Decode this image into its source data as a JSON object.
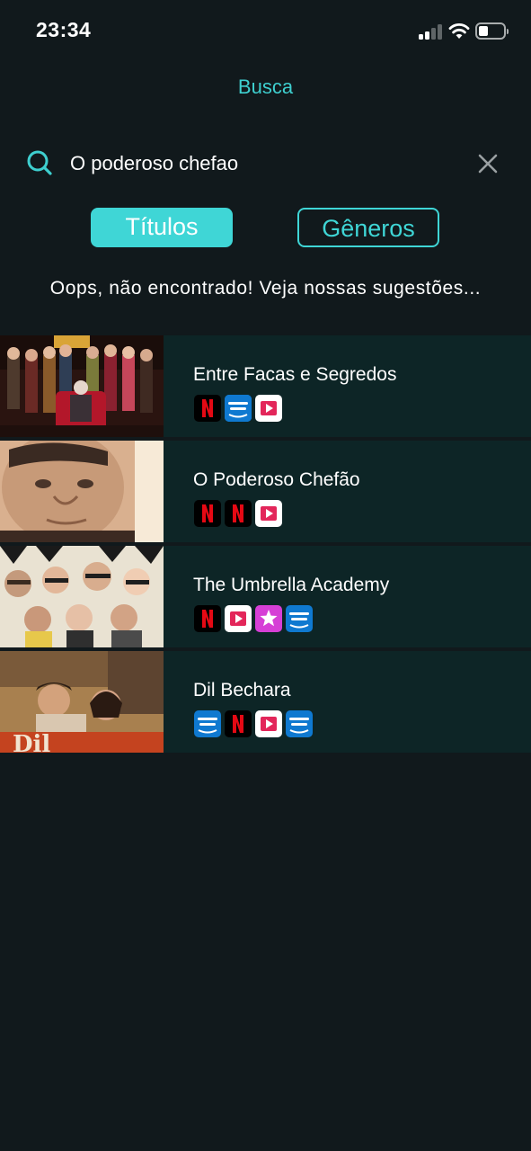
{
  "status_bar": {
    "time": "23:34",
    "icons": [
      "cellular-signal-icon",
      "wifi-icon",
      "battery-icon"
    ]
  },
  "header": {
    "title": "Busca"
  },
  "search": {
    "value": "O poderoso chefao",
    "icon": "search-icon",
    "clear_icon": "close-icon"
  },
  "tabs": [
    {
      "label": "Títulos",
      "active": true
    },
    {
      "label": "Gêneros",
      "active": false
    }
  ],
  "message": "Oops, não encontrado! Veja nossas sugestões...",
  "results": [
    {
      "title": "Entre Facas e Segredos",
      "providers": [
        "netflix",
        "prime-video",
        "google-play-movies"
      ]
    },
    {
      "title": "O Poderoso Chefão",
      "providers": [
        "netflix",
        "netflix",
        "google-play-movies"
      ]
    },
    {
      "title": "The Umbrella Academy",
      "providers": [
        "netflix",
        "google-play-movies",
        "itunes-star"
      ]
    },
    {
      "title": "Dil Bechara",
      "providers": [
        "prime-video",
        "netflix",
        "google-play-movies",
        "prime-video"
      ]
    }
  ],
  "colors": {
    "background": "#11191c",
    "accent": "#3fd6d6",
    "row_background": "#0d2526"
  }
}
